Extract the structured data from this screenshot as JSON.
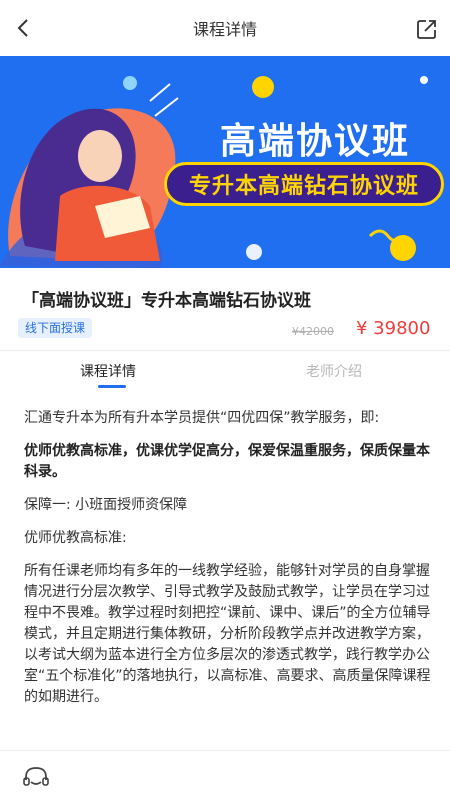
{
  "header": {
    "title": "课程详情",
    "back_icon": "chevron-left-icon",
    "share_icon": "share-icon"
  },
  "banner": {
    "title": "高端协议班",
    "subtitle": "专升本高端钻石协议班",
    "colors": {
      "background": "#1f6ff0",
      "pill_bg": "#3b1f8e",
      "pill_text": "#ffd400",
      "accent": "#f47a5a"
    }
  },
  "course": {
    "name": "「高端协议班」专升本高端钻石协议班",
    "mode_tag": "线下面授课",
    "original_price": "¥42000",
    "price": "¥ 39800"
  },
  "tabs": [
    {
      "label": "课程详情",
      "active": true
    },
    {
      "label": "老师介绍",
      "active": false
    }
  ],
  "content": {
    "intro": "汇通专升本为所有升本学员提供“四优四保”教学服务，即:",
    "highlight": "优师优教高标准，优课优学促高分，保爱保温重服务，保质保量本科录。",
    "guarantee_1": "保障一: 小班面授师资保障",
    "subheading": "优师优教高标准:",
    "body": "所有任课老师均有多年的一线教学经验，能够针对学员的自身掌握情况进行分层次教学、引导式教学及鼓励式教学，让学员在学习过程中不畏难。教学过程时刻把控“课前、课中、课后”的全方位辅导模式，并且定期进行集体教研，分析阶段教学点并改进教学方案，以考试大纲为蓝本进行全方位多层次的渗透式教学，践行教学办公室“五个标准化”的落地执行，以高标准、高要求、高质量保障课程的如期进行。"
  },
  "bottom_bar": {
    "service_icon": "customer-service-icon"
  }
}
